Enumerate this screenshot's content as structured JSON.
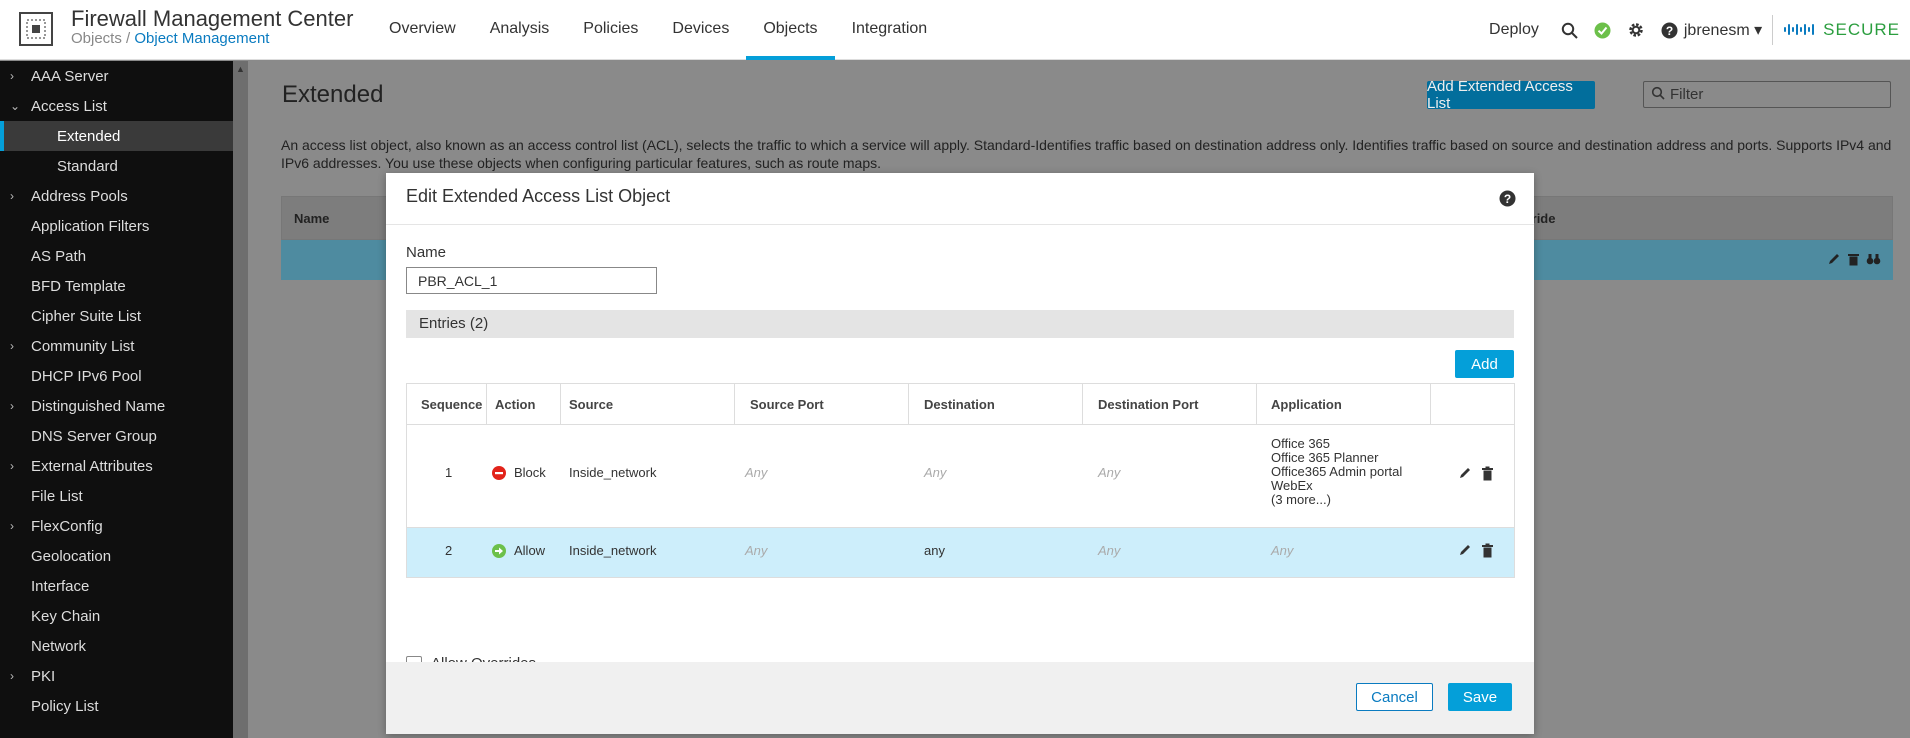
{
  "header": {
    "app_title": "Firewall Management Center",
    "breadcrumb": {
      "parent": "Objects",
      "separator": "/",
      "current": "Object Management"
    },
    "nav": [
      {
        "label": "Overview"
      },
      {
        "label": "Analysis"
      },
      {
        "label": "Policies"
      },
      {
        "label": "Devices"
      },
      {
        "label": "Objects"
      },
      {
        "label": "Integration"
      }
    ],
    "active_nav": "Objects",
    "deploy_label": "Deploy",
    "user_label": "jbrenesm ▾",
    "brand": "SECURE",
    "status_color": "#6cc04a",
    "accent": "#049fd9"
  },
  "sidebar": {
    "items": [
      {
        "label": "AAA Server",
        "chevron": "›"
      },
      {
        "label": "Access List",
        "chevron": "⌄"
      },
      {
        "label": "Extended",
        "chevron": ""
      },
      {
        "label": "Standard",
        "chevron": ""
      },
      {
        "label": "Address Pools",
        "chevron": "›"
      },
      {
        "label": "Application Filters",
        "chevron": ""
      },
      {
        "label": "AS Path",
        "chevron": ""
      },
      {
        "label": "BFD Template",
        "chevron": ""
      },
      {
        "label": "Cipher Suite List",
        "chevron": ""
      },
      {
        "label": "Community List",
        "chevron": "›"
      },
      {
        "label": "DHCP IPv6 Pool",
        "chevron": ""
      },
      {
        "label": "Distinguished Name",
        "chevron": "›"
      },
      {
        "label": "DNS Server Group",
        "chevron": ""
      },
      {
        "label": "External Attributes",
        "chevron": "›"
      },
      {
        "label": "File List",
        "chevron": ""
      },
      {
        "label": "FlexConfig",
        "chevron": "›"
      },
      {
        "label": "Geolocation",
        "chevron": ""
      },
      {
        "label": "Interface",
        "chevron": ""
      },
      {
        "label": "Key Chain",
        "chevron": ""
      },
      {
        "label": "Network",
        "chevron": ""
      },
      {
        "label": "PKI",
        "chevron": "›"
      },
      {
        "label": "Policy List",
        "chevron": ""
      }
    ]
  },
  "page": {
    "title": "Extended",
    "add_button": "Add Extended Access List",
    "filter_placeholder": "Filter",
    "description": "An access list object, also known as an access control list (ACL), selects the traffic to which a service will apply. Standard-Identifies traffic based on destination address only. Identifies traffic based on source and destination address and ports. Supports IPv4 and IPv6 addresses. You use these objects when configuring particular features, such as route maps.",
    "table_headers": {
      "name": "Name",
      "override": "Override"
    }
  },
  "modal": {
    "title": "Edit Extended Access List Object",
    "name_label": "Name",
    "name_value": "PBR_ACL_1",
    "entries_label": "Entries (2)",
    "add_label": "Add",
    "columns": [
      "Sequence",
      "Action",
      "Source",
      "Source Port",
      "Destination",
      "Destination Port",
      "Application"
    ],
    "rows": [
      {
        "sequence": "1",
        "action": "Block",
        "source": "Inside_network",
        "source_port": "Any",
        "destination": "Any",
        "destination_port": "Any",
        "application": [
          "Office 365",
          "Office 365 Planner",
          "Office365 Admin portal",
          "WebEx",
          "(3 more...)"
        ]
      },
      {
        "sequence": "2",
        "action": "Allow",
        "source": "Inside_network",
        "source_port": "Any",
        "destination": "any",
        "destination_port": "Any",
        "application": "Any"
      }
    ],
    "allow_overrides_label": "Allow Overrides",
    "cancel_label": "Cancel",
    "save_label": "Save",
    "block_color": "#e2231a",
    "allow_color": "#6cc04a"
  }
}
